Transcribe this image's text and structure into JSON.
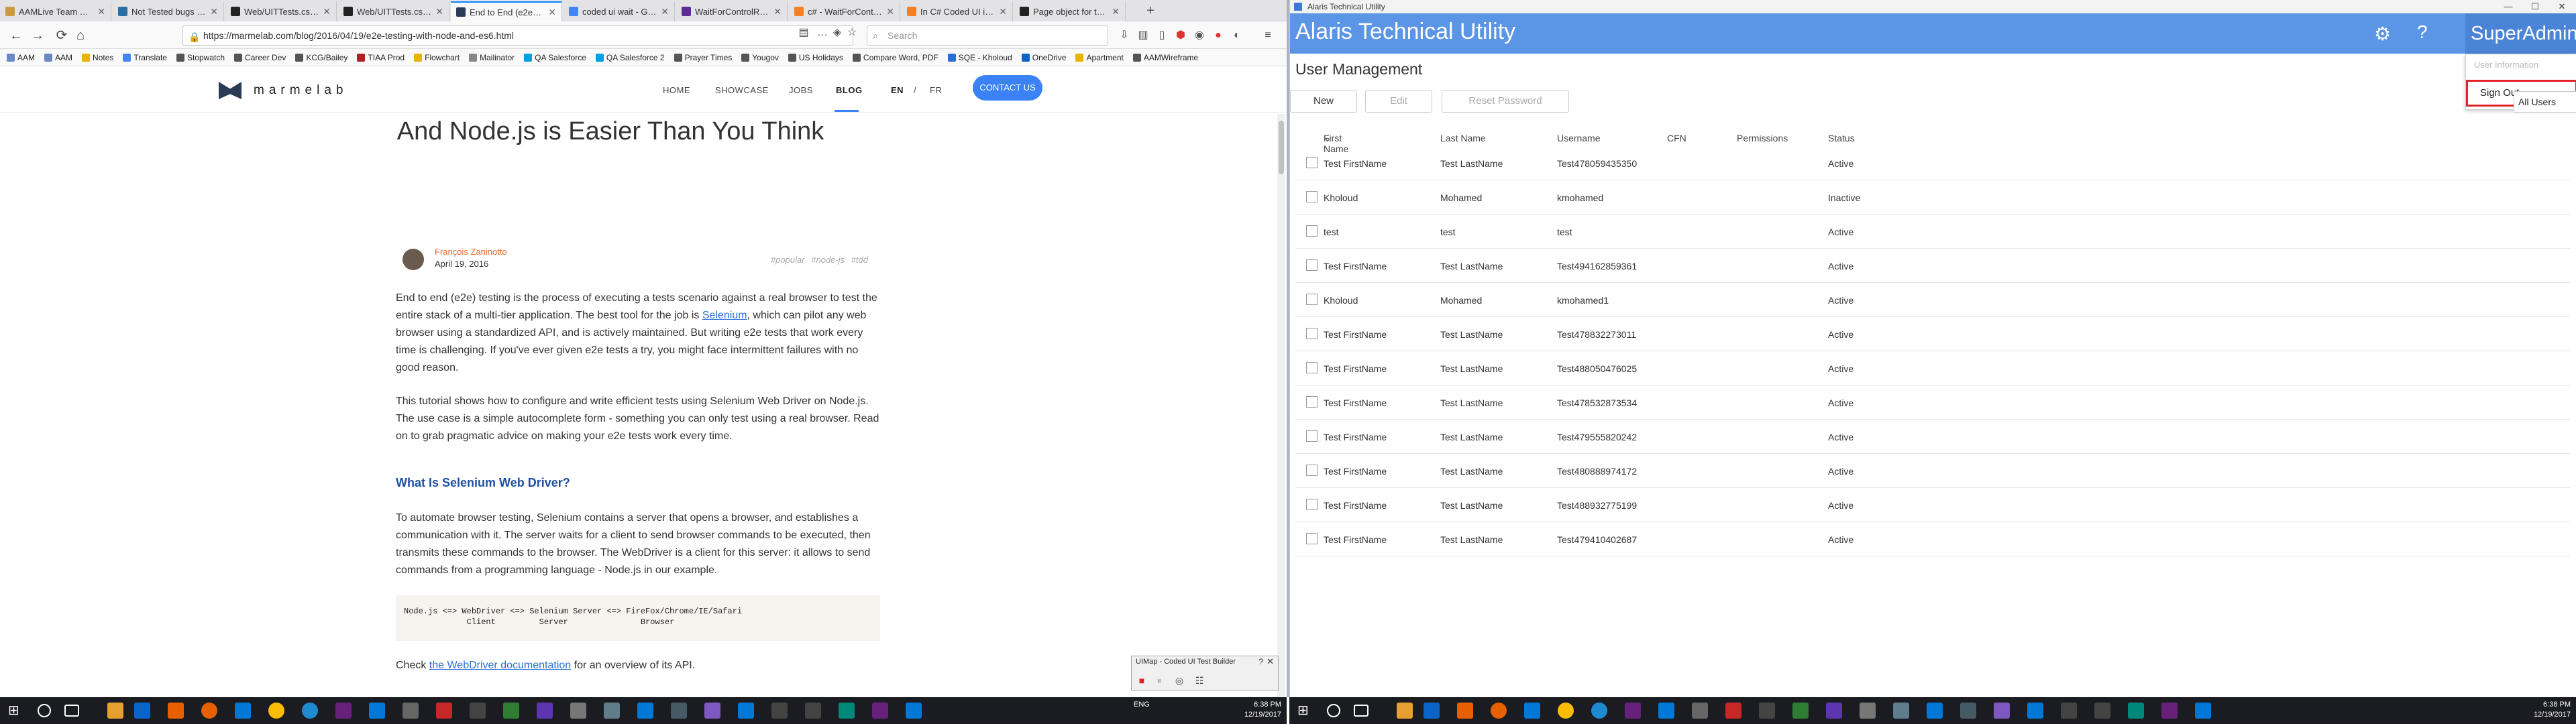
{
  "browser": {
    "tabs": [
      {
        "title": "AAMLive Team Spring"
      },
      {
        "title": "Not Tested bugs tasks"
      },
      {
        "title": "Web/UITTests.cs at..."
      },
      {
        "title": "Web/UITTests.cs at..."
      },
      {
        "title": "End to End (e2e) Tes..."
      },
      {
        "title": "coded ui wait - Goo..."
      },
      {
        "title": "WaitForControlRea..."
      },
      {
        "title": "c# - WaitForControlR..."
      },
      {
        "title": "In C# Coded UI is th..."
      },
      {
        "title": "Page object for testi..."
      }
    ],
    "url": "https://marmelab.com/blog/2016/04/19/e2e-testing-with-node-and-es6.html",
    "search_placeholder": "Search",
    "bookmarks": [
      "AAM",
      "AAM",
      "Notes",
      "Translate",
      "Stopwatch",
      "Career Dev",
      "KCG/Bailey",
      "TIAA Prod",
      "Flowchart",
      "Mailinator",
      "QA Salesforce",
      "QA Salesforce 2",
      "Prayer Times",
      "Yougov",
      "US Holidays",
      "Compare Word, PDF",
      "SQE - Kholoud",
      "OneDrive",
      "Apartment",
      "AAMWireframe"
    ]
  },
  "site": {
    "logo": "marmelab",
    "nav": [
      "HOME",
      "SHOWCASE",
      "JOBS",
      "BLOG",
      "EN",
      "/",
      "FR"
    ],
    "contact": "CONTACT US"
  },
  "article": {
    "title": "And Node.js is Easier Than You Think",
    "author": "François Zaninotto",
    "date": "April 19, 2016",
    "tags": "#popular #node-js #tdd",
    "p1a": "End to end (e2e) testing is the process of executing a tests scenario against a real browser to test the entire stack of a multi-tier application. The best tool for the job is ",
    "p1link": "Selenium",
    "p1b": ", which can pilot any web browser using a standardized API, and is actively maintained. But writing e2e tests that work every time is challenging. If you've ever given e2e tests a try, you might face intermittent failures with no good reason.",
    "p2": "This tutorial shows how to configure and write efficient tests using Selenium Web Driver on Node.js. The use case is a simple autocomplete form - something you can only test using a real browser. Read on to grab pragmatic advice on making your e2e tests work every time.",
    "h3": "What Is Selenium Web Driver?",
    "p3": "To automate browser testing, Selenium contains a server that opens a browser, and establishes a communication with it. The server waits for a client to send browser commands to be executed, then transmits these commands to the browser. The WebDriver is a client for this server: it allows to send commands from a programming language - Node.js in our example.",
    "code": "Node.js <=> WebDriver <=> Selenium Server <=> FireFox/Chrome/IE/Safari\n             Client         Server               Browser",
    "p4a": "Check ",
    "p4link": "the WebDriver documentation",
    "p4b": " for an overview of its API."
  },
  "uimap": {
    "title": "UIMap - Coded UI Test Builder",
    "help": "?",
    "close": "✕"
  },
  "app": {
    "window_title": "Alaris Technical Utility",
    "title": "Alaris Technical Utility",
    "user": "SuperAdmin",
    "dropdown": {
      "item1": "User Information",
      "item2": "Sign Out"
    },
    "section": "User Management",
    "buttons": {
      "new": "New",
      "edit": "Edit",
      "reset": "Reset Password"
    },
    "filter": "All Users",
    "columns": [
      "First Name",
      "Last Name",
      "Username",
      "CFN",
      "Permissions",
      "Status"
    ],
    "rows": [
      {
        "first": "Test FirstName",
        "last": "Test LastName",
        "user": "Test478059435350",
        "status": "Active"
      },
      {
        "first": "Kholoud",
        "last": "Mohamed",
        "user": "kmohamed",
        "status": "Inactive"
      },
      {
        "first": "test",
        "last": "test",
        "user": "test",
        "status": "Active"
      },
      {
        "first": "Test FirstName",
        "last": "Test LastName",
        "user": "Test494162859361",
        "status": "Active"
      },
      {
        "first": "Kholoud",
        "last": "Mohamed",
        "user": "kmohamed1",
        "status": "Active"
      },
      {
        "first": "Test FirstName",
        "last": "Test LastName",
        "user": "Test478832273011",
        "status": "Active"
      },
      {
        "first": "Test FirstName",
        "last": "Test LastName",
        "user": "Test488050476025",
        "status": "Active"
      },
      {
        "first": "Test FirstName",
        "last": "Test LastName",
        "user": "Test478532873534",
        "status": "Active"
      },
      {
        "first": "Test FirstName",
        "last": "Test LastName",
        "user": "Test479555820242",
        "status": "Active"
      },
      {
        "first": "Test FirstName",
        "last": "Test LastName",
        "user": "Test480888974172",
        "status": "Active"
      },
      {
        "first": "Test FirstName",
        "last": "Test LastName",
        "user": "Test488932775199",
        "status": "Active"
      },
      {
        "first": "Test FirstName",
        "last": "Test LastName",
        "user": "Test479410402687",
        "status": "Active"
      }
    ]
  },
  "taskbar": {
    "time": "6:38 PM",
    "date": "12/19/2017",
    "lang": "ENG"
  },
  "colors": {
    "accent": "#5b95e6",
    "highlight": "#e0232b",
    "link": "#2b6fd6",
    "contact": "#3b82f6"
  }
}
